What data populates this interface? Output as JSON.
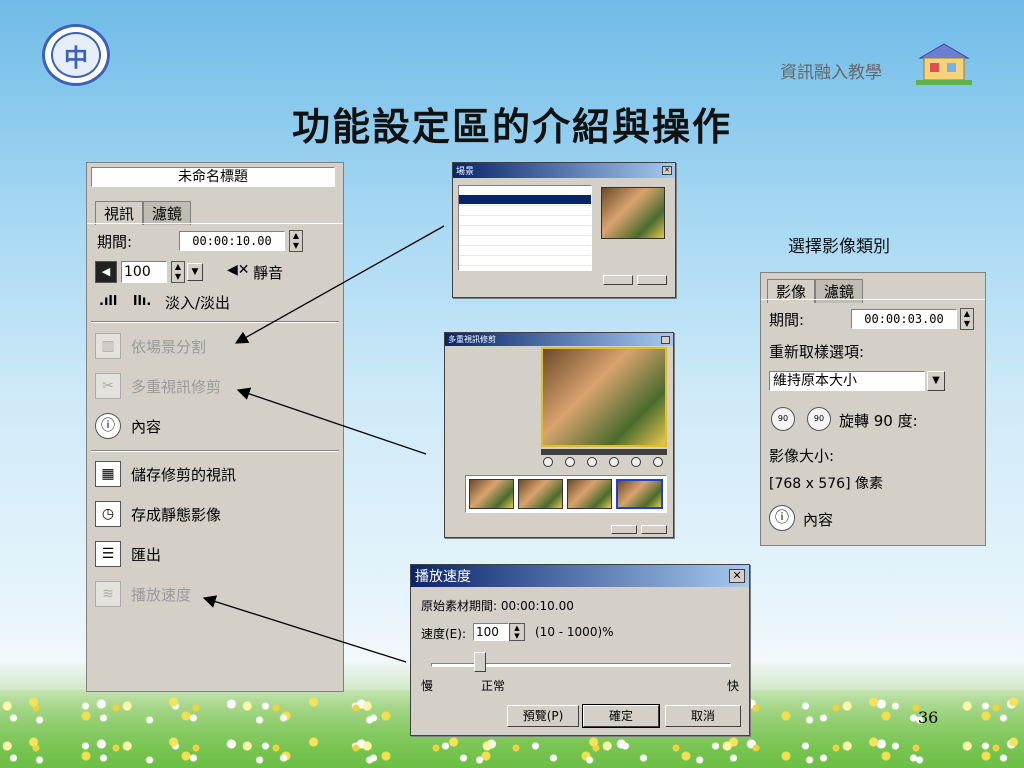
{
  "slide": {
    "brand": "資訊融入教學",
    "title": "功能設定區的介紹與操作",
    "page_number": "36",
    "logo_glyph": "中"
  },
  "left_panel": {
    "title": "未命名標題",
    "tabs": [
      "視訊",
      "濾鏡"
    ],
    "duration_label": "期間:",
    "duration_value": "00:00:10.00",
    "volume_value": "100",
    "mute_label": "靜音",
    "fade_label": "淡入/淡出",
    "items": [
      {
        "label": "依場景分割",
        "icon": "split-scene-icon",
        "enabled": false
      },
      {
        "label": "多重視訊修剪",
        "icon": "multi-trim-icon",
        "enabled": false
      },
      {
        "label": "內容",
        "icon": "properties-icon",
        "enabled": true
      },
      {
        "label": "儲存修剪的視訊",
        "icon": "save-trim-icon",
        "enabled": true
      },
      {
        "label": "存成靜態影像",
        "icon": "save-still-icon",
        "enabled": true
      },
      {
        "label": "匯出",
        "icon": "export-icon",
        "enabled": true
      },
      {
        "label": "播放速度",
        "icon": "playback-speed-icon",
        "enabled": false
      }
    ]
  },
  "right_label": "選擇影像類別",
  "right_panel": {
    "tabs": [
      "影像",
      "濾鏡"
    ],
    "duration_label": "期間:",
    "duration_value": "00:00:03.00",
    "resample_label": "重新取樣選項:",
    "resample_value": "維持原本大小",
    "rotate_label": "旋轉 90 度:",
    "rotate_icon_text": "90",
    "size_label": "影像大小:",
    "size_value": "[768 x 576] 像素",
    "properties_label": "內容"
  },
  "scene_dialog": {
    "title": "場景",
    "close": "✕"
  },
  "multitrim_dialog": {
    "title": "多重視訊修剪"
  },
  "speed_dialog": {
    "title": "播放速度",
    "close": "✕",
    "original_label": "原始素材期間: 00:00:10.00",
    "speed_label": "速度(E):",
    "speed_value": "100",
    "range_label": "(10 - 1000)%",
    "slow": "慢",
    "normal": "正常",
    "fast": "快",
    "slider_level_percent": 16,
    "buttons": [
      "預覽(P)",
      "確定",
      "取消"
    ]
  }
}
